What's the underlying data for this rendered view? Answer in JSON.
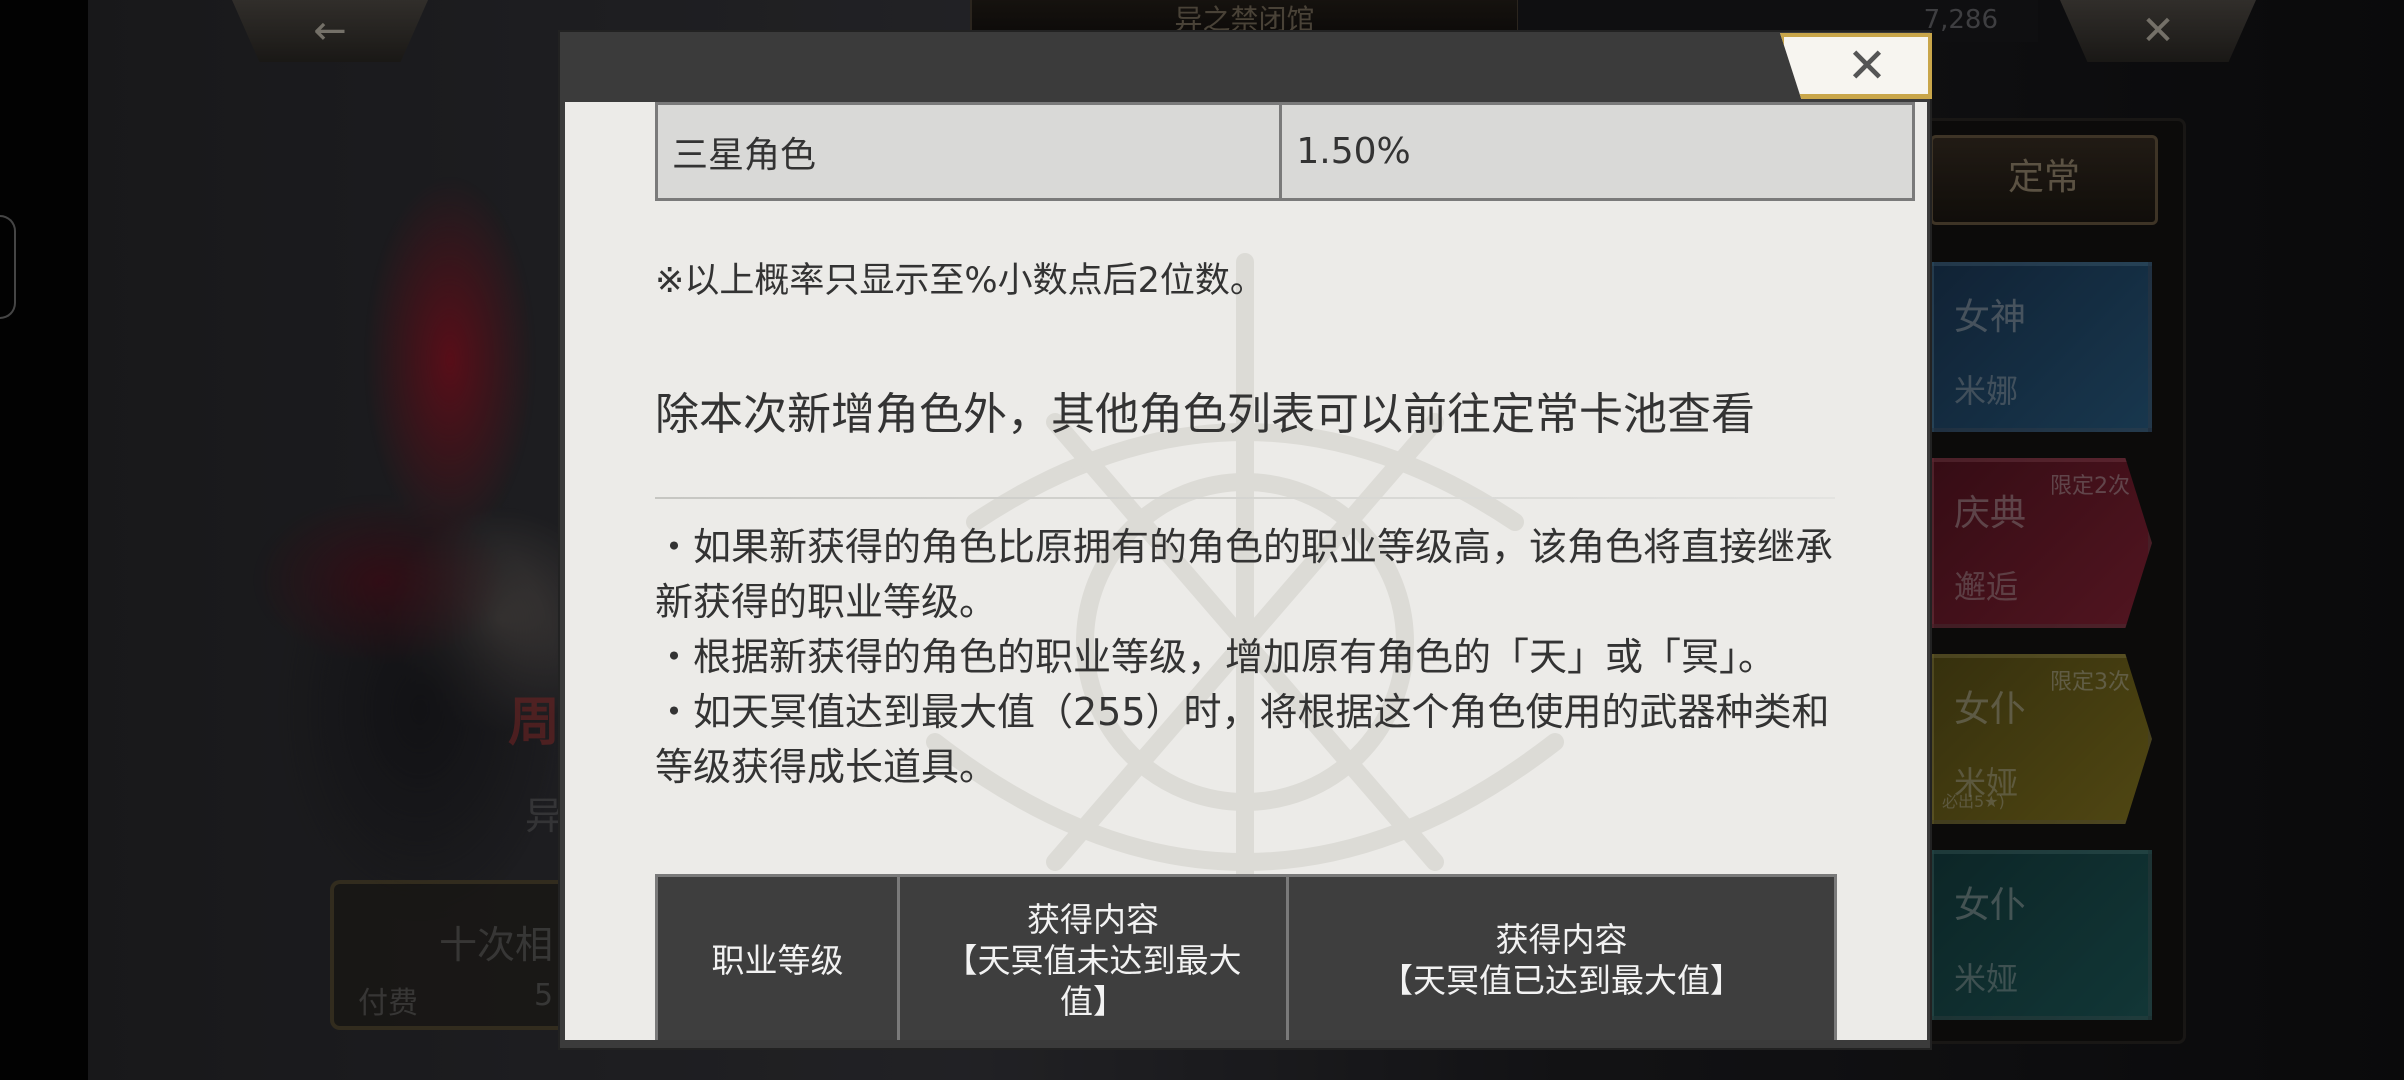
{
  "background": {
    "top_back_icon": "back-arrow-icon",
    "top_title": "异之禁闭馆",
    "gem_count": "7,286",
    "top_close_icon": "close-icon",
    "fixed_tab_label": "定常",
    "banners": [
      {
        "line1": "女神",
        "line2": "米娜",
        "limit": ""
      },
      {
        "line1": "庆典",
        "line2": "邂逅",
        "limit": "限定2次"
      },
      {
        "line1": "女仆",
        "line2": "米娅",
        "limit": "限定3次",
        "note": "必出5★)"
      },
      {
        "line1": "女仆",
        "line2": "米娅",
        "limit": ""
      }
    ],
    "left_label_1": "周",
    "left_label_2": "异",
    "left_button_title": "十次相",
    "left_button_pay": "付费",
    "left_button_cost": "5"
  },
  "modal": {
    "close_icon": "close-x-icon",
    "rate_table": [
      {
        "name": "三星角色",
        "rate": "1.50%"
      }
    ],
    "note": "※以上概率只显示至%小数点后2位数。",
    "section_heading": "除本次新增角色外，其他角色列表可以前往定常卡池查看",
    "bullets": [
      "・如果新获得的角色比原拥有的角色的职业等级高，该角色将直接继承新获得的职业等级。",
      "・根据新获得的角色的职业等级，增加原有角色的「天」或「冥」。",
      "・如天冥值达到最大值（255）时，将根据这个角色使用的武器种类和等级获得成长道具。"
    ],
    "class_table_headers": {
      "col1": "职业等级",
      "col2_line1": "获得内容",
      "col2_line2": "【天冥值未达到最大",
      "col2_line3": "值】",
      "col3_line1": "获得内容",
      "col3_line2": "【天冥值已达到最大值】"
    }
  }
}
